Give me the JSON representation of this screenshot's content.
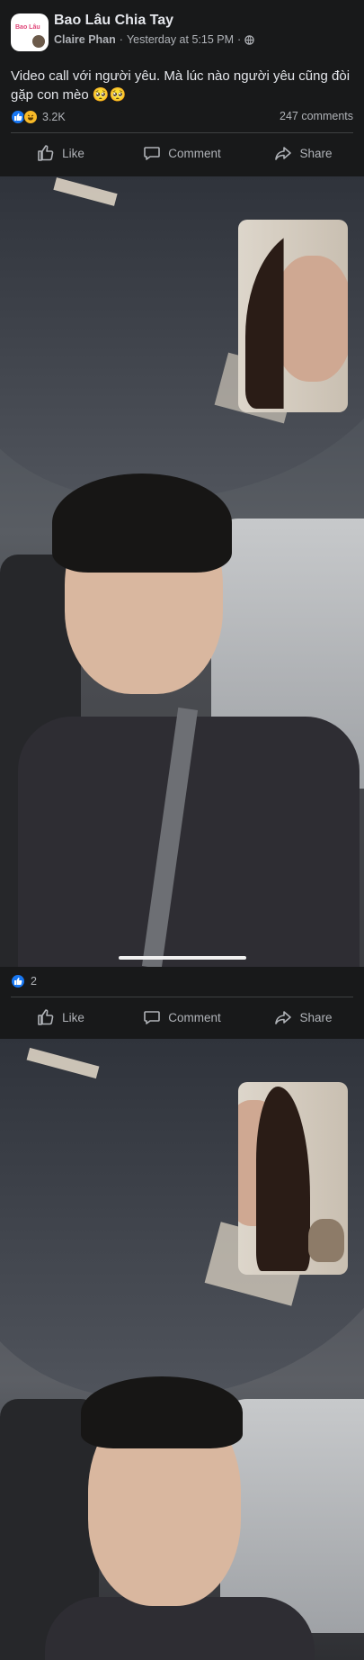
{
  "post": {
    "page_name": "Bao Lâu Chia Tay",
    "avatar_logo_text": "Bao Lâu",
    "author": "Claire Phan",
    "timestamp": "Yesterday at 5:15 PM",
    "separator": "·",
    "privacy_icon": "globe-icon",
    "caption": "Video call với người yêu. Mà lúc nào người yêu cũng đòi gặp con mèo 🥺🥺"
  },
  "post_stats": {
    "reaction_icons": [
      "like-icon",
      "haha-icon"
    ],
    "reaction_count": "3.2K",
    "comment_count": "247 comments"
  },
  "actions": {
    "like_label": "Like",
    "comment_label": "Comment",
    "share_label": "Share"
  },
  "photo_1": {
    "reaction_icons": [
      "like-icon"
    ],
    "reaction_count": "2"
  },
  "colors": {
    "background": "#18191a",
    "text_primary": "#e4e6eb",
    "text_secondary": "#b0b3b8",
    "divider": "#3e4042",
    "like_blue": "#1877f2",
    "haha_yellow": "#f7b928"
  }
}
